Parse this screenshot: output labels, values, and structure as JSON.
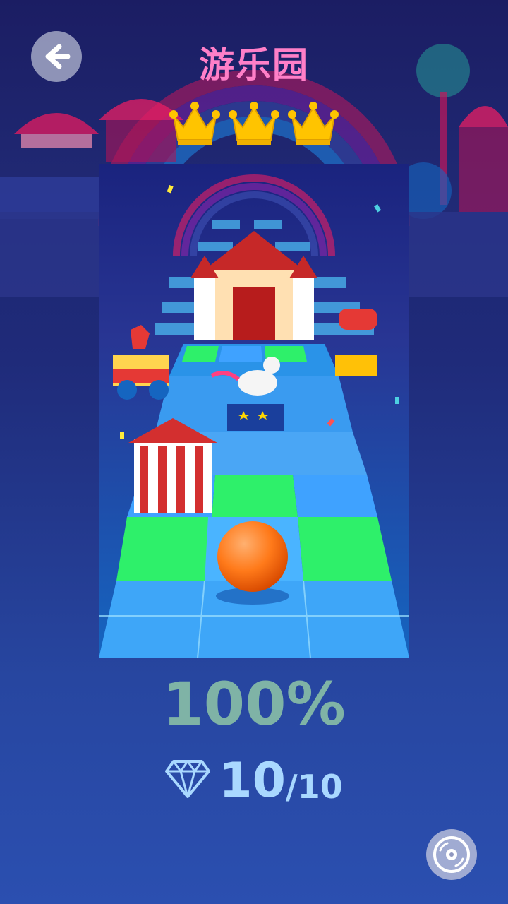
{
  "level": {
    "title": "游乐园",
    "crowns_earned": 3,
    "crowns_total": 3
  },
  "progress": {
    "percent_label": "100%"
  },
  "gems": {
    "collected": "10",
    "total_label": "/10"
  },
  "icons": {
    "back": "arrow-left-icon",
    "crown": "crown-icon",
    "gem": "diamond-icon",
    "disc": "music-disc-icon"
  },
  "colors": {
    "title": "#ff7fc8",
    "crown": "#ffc400",
    "percent": "#7fb3a6",
    "gems": "#a9d8ff",
    "ball": "#ff7a1a",
    "tile_green": "#2ef06a",
    "tile_blue": "#3fa2ff"
  }
}
